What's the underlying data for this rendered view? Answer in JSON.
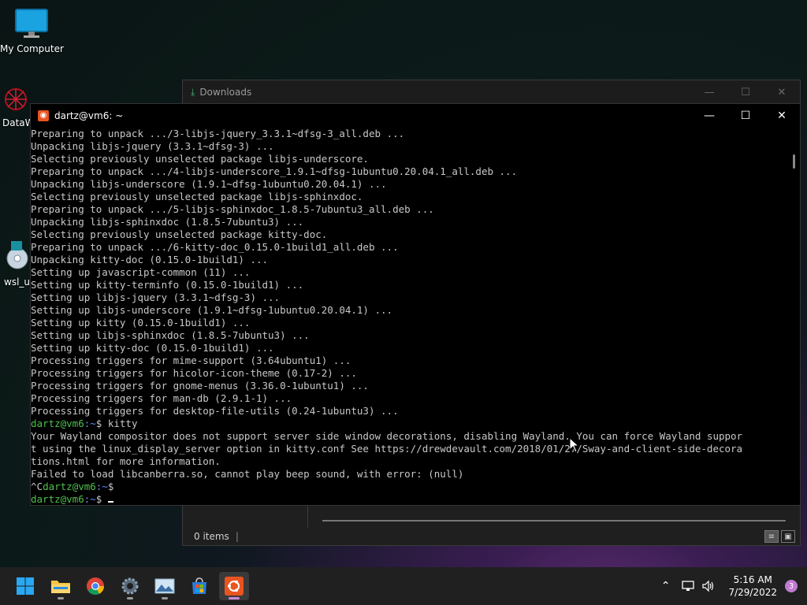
{
  "desktop": {
    "icons": [
      {
        "label": "My Computer",
        "icon": "computer-icon"
      },
      {
        "label": "DataW",
        "icon": "app-shortcut-icon"
      },
      {
        "label": "wsl_up",
        "icon": "disc-icon"
      }
    ]
  },
  "downloads_window": {
    "title": "Downloads",
    "status_items": "0 items",
    "status_sep": "|",
    "controls": {
      "minimize": "—",
      "maximize": "☐",
      "close": "✕"
    }
  },
  "terminal_window": {
    "title": "dartz@vm6: ~",
    "controls": {
      "minimize": "—",
      "maximize": "☐",
      "close": "✕"
    },
    "lines": [
      "Preparing to unpack .../3-libjs-jquery_3.3.1~dfsg-3_all.deb ...",
      "Unpacking libjs-jquery (3.3.1~dfsg-3) ...",
      "Selecting previously unselected package libjs-underscore.",
      "Preparing to unpack .../4-libjs-underscore_1.9.1~dfsg-1ubuntu0.20.04.1_all.deb ...",
      "Unpacking libjs-underscore (1.9.1~dfsg-1ubuntu0.20.04.1) ...",
      "Selecting previously unselected package libjs-sphinxdoc.",
      "Preparing to unpack .../5-libjs-sphinxdoc_1.8.5-7ubuntu3_all.deb ...",
      "Unpacking libjs-sphinxdoc (1.8.5-7ubuntu3) ...",
      "Selecting previously unselected package kitty-doc.",
      "Preparing to unpack .../6-kitty-doc_0.15.0-1build1_all.deb ...",
      "Unpacking kitty-doc (0.15.0-1build1) ...",
      "Setting up javascript-common (11) ...",
      "Setting up kitty-terminfo (0.15.0-1build1) ...",
      "Setting up libjs-jquery (3.3.1~dfsg-3) ...",
      "Setting up libjs-underscore (1.9.1~dfsg-1ubuntu0.20.04.1) ...",
      "Setting up kitty (0.15.0-1build1) ...",
      "Setting up libjs-sphinxdoc (1.8.5-7ubuntu3) ...",
      "Setting up kitty-doc (0.15.0-1build1) ...",
      "Processing triggers for mime-support (3.64ubuntu1) ...",
      "Processing triggers for hicolor-icon-theme (0.17-2) ...",
      "Processing triggers for gnome-menus (3.36.0-1ubuntu1) ...",
      "Processing triggers for man-db (2.9.1-1) ...",
      "Processing triggers for desktop-file-utils (0.24-1ubuntu3) ..."
    ],
    "prompt_user": "dartz@vm6",
    "prompt_path": ":~",
    "prompt_symbol": "$",
    "command": " kitty",
    "output_lines": [
      "Your Wayland compositor does not support server side window decorations, disabling Wayland. You can force Wayland suppor",
      "t using the linux_display_server option in kitty.conf See https://drewdevault.com/2018/01/27/Sway-and-client-side-decora",
      "tions.html for more information.",
      "Failed to load libcanberra.so, cannot play beep sound, with error: (null)"
    ],
    "interrupt": "^C",
    "colors": {
      "prompt_user": "#4fc14f",
      "prompt_path": "#6a8cff",
      "text": "#c8c8c8"
    }
  },
  "taskbar": {
    "apps": [
      {
        "name": "start",
        "icon": "windows-start-icon"
      },
      {
        "name": "file-explorer",
        "icon": "folder-icon"
      },
      {
        "name": "chrome",
        "icon": "chrome-icon"
      },
      {
        "name": "settings",
        "icon": "gear-icon"
      },
      {
        "name": "photos",
        "icon": "photos-icon"
      },
      {
        "name": "store",
        "icon": "store-icon"
      },
      {
        "name": "ubuntu",
        "icon": "ubuntu-icon"
      }
    ],
    "time": "5:16 AM",
    "date": "7/29/2022",
    "notification_count": "3"
  }
}
